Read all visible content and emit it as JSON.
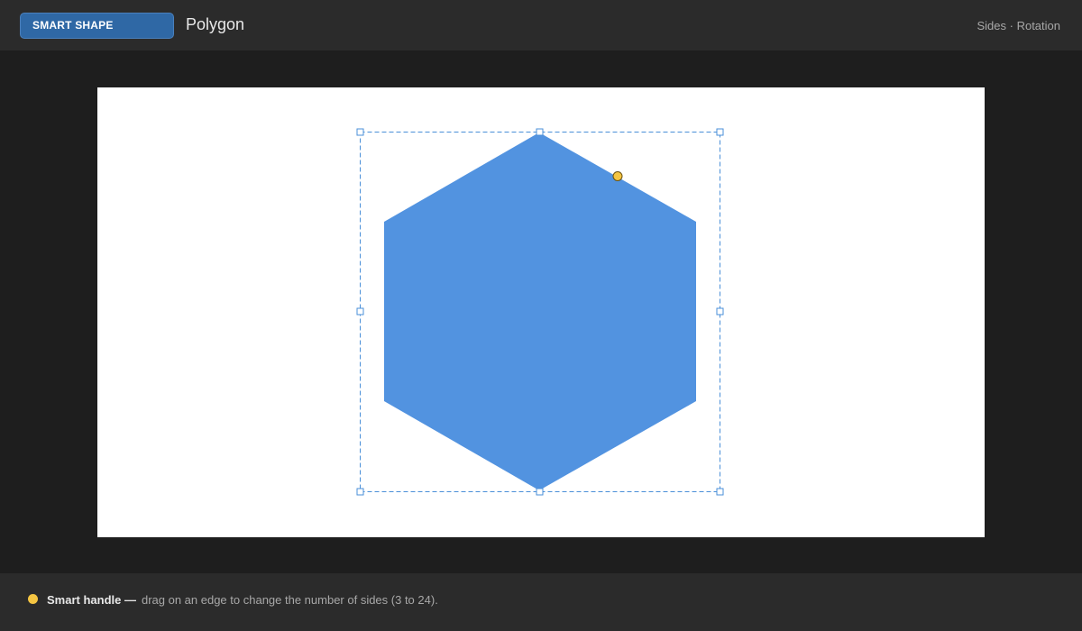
{
  "header": {
    "badge_label": "SMART SHAPE",
    "title": "Polygon",
    "right_hint": "Sides · Rotation"
  },
  "shape": {
    "type": "polygon",
    "sides": 6,
    "fill_color": "#5293e0"
  },
  "colors": {
    "accent": "#2f68a5",
    "selection": "#4a8fd8",
    "smart_handle": "#f5c542",
    "canvas": "#ffffff"
  },
  "footer": {
    "handle_label": "Smart handle —",
    "description": "drag on an edge to change the number of sides (3 to 24)."
  }
}
